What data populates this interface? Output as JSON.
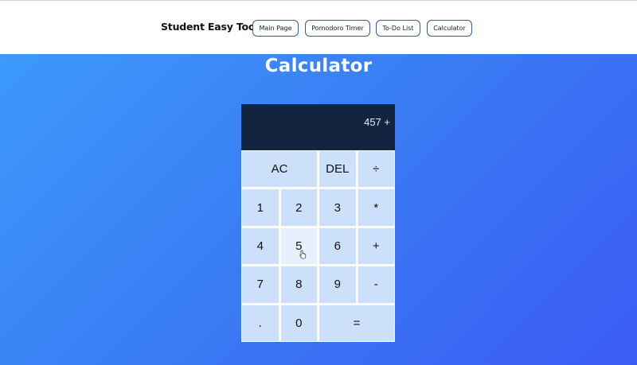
{
  "header": {
    "brand": "Student Easy Tools",
    "nav": [
      {
        "label": "Main Page"
      },
      {
        "label": "Pomodoro Timer"
      },
      {
        "label": "To-Do List"
      },
      {
        "label": "Calculator"
      }
    ]
  },
  "main": {
    "title": "Calculator"
  },
  "calculator": {
    "display": "457 +",
    "keys": [
      "AC",
      "DEL",
      "÷",
      "1",
      "2",
      "3",
      "*",
      "4",
      "5",
      "6",
      "+",
      "7",
      "8",
      "9",
      "-",
      ".",
      "0",
      "="
    ]
  },
  "colors": {
    "display_bg": "#12243f",
    "key_bg": "#cde0fb",
    "nav_border": "#3a5aa8"
  },
  "icons": {
    "cursor": "hand-pointer-icon"
  }
}
